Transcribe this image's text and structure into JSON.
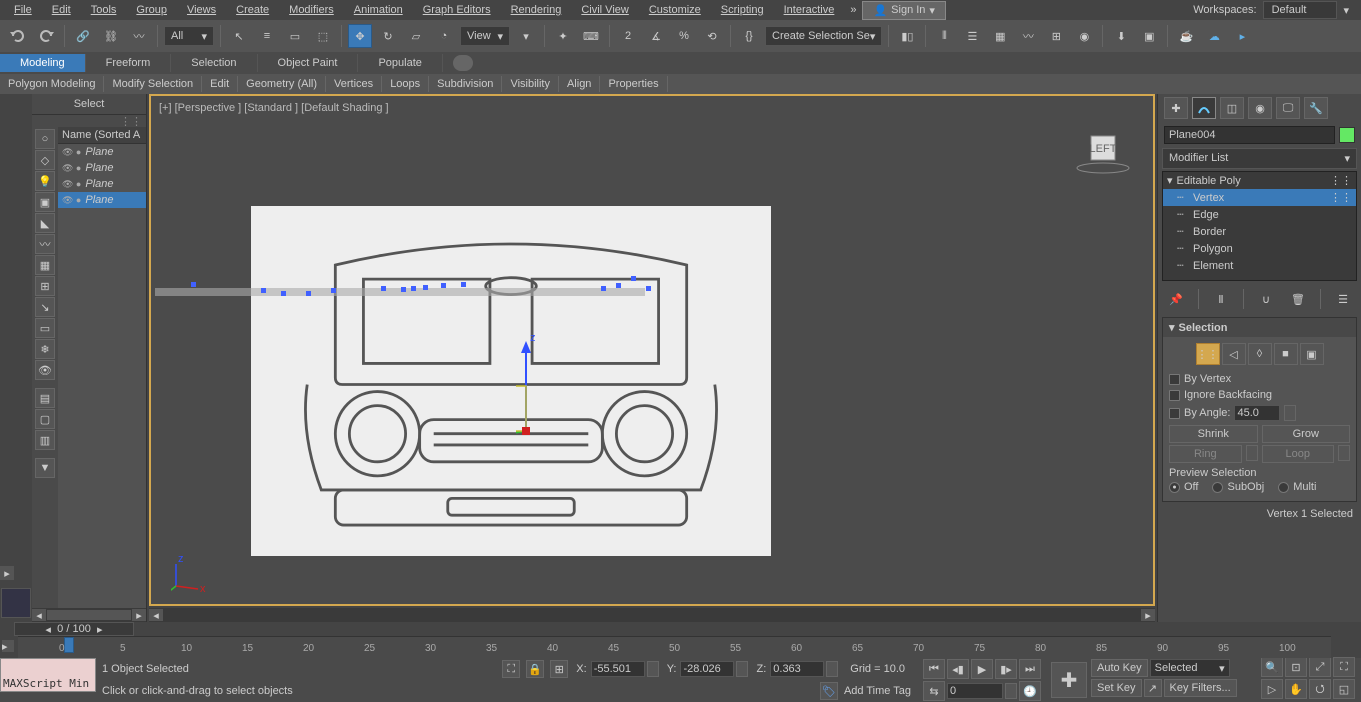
{
  "menu": [
    "File",
    "Edit",
    "Tools",
    "Group",
    "Views",
    "Create",
    "Modifiers",
    "Animation",
    "Graph Editors",
    "Rendering",
    "Civil View",
    "Customize",
    "Scripting",
    "Interactive"
  ],
  "sign_in": "Sign In",
  "workspaces_label": "Workspaces:",
  "workspaces_value": "Default",
  "toolbar": {
    "all": "All",
    "view": "View",
    "create_sel": "Create Selection Se"
  },
  "ribbon_tabs": [
    "Modeling",
    "Freeform",
    "Selection",
    "Object Paint",
    "Populate"
  ],
  "ribbon_sub": [
    "Polygon Modeling",
    "Modify Selection",
    "Edit",
    "Geometry (All)",
    "Vertices",
    "Loops",
    "Subdivision",
    "Visibility",
    "Align",
    "Properties"
  ],
  "scene": {
    "title": "Select",
    "header": "Name (Sorted A",
    "items": [
      "Plane",
      "Plane",
      "Plane",
      "Plane"
    ]
  },
  "viewport": {
    "label": "[+] [Perspective ] [Standard ] [Default Shading ]",
    "cube_face": "LEFT"
  },
  "time_slider": "0 / 100",
  "ruler_ticks": [
    0,
    5,
    10,
    15,
    20,
    25,
    30,
    35,
    40,
    45,
    50,
    55,
    60,
    65,
    70,
    75,
    80,
    85,
    90,
    95,
    100
  ],
  "cmd": {
    "object_name": "Plane004",
    "modifier_list": "Modifier List",
    "stack": {
      "root": "Editable Poly",
      "subs": [
        "Vertex",
        "Edge",
        "Border",
        "Polygon",
        "Element"
      ]
    },
    "selection": {
      "title": "Selection",
      "by_vertex": "By Vertex",
      "ignore_backfacing": "Ignore Backfacing",
      "by_angle": "By Angle:",
      "angle_val": "45.0",
      "shrink": "Shrink",
      "grow": "Grow",
      "ring": "Ring",
      "loop": "Loop",
      "preview": "Preview Selection",
      "off": "Off",
      "subobj": "SubObj",
      "multi": "Multi",
      "status": "Vertex 1 Selected"
    }
  },
  "status": {
    "selected": "1 Object Selected",
    "prompt": "Click or click-and-drag to select objects",
    "script": "MAXScript Min",
    "x": "-55.501",
    "y": "-28.026",
    "z": "0.363",
    "grid": "Grid = 10.0",
    "frame": "0",
    "add_time_tag": "Add Time Tag",
    "auto_key": "Auto Key",
    "set_key": "Set Key",
    "selected_filter": "Selected",
    "key_filters": "Key Filters..."
  }
}
